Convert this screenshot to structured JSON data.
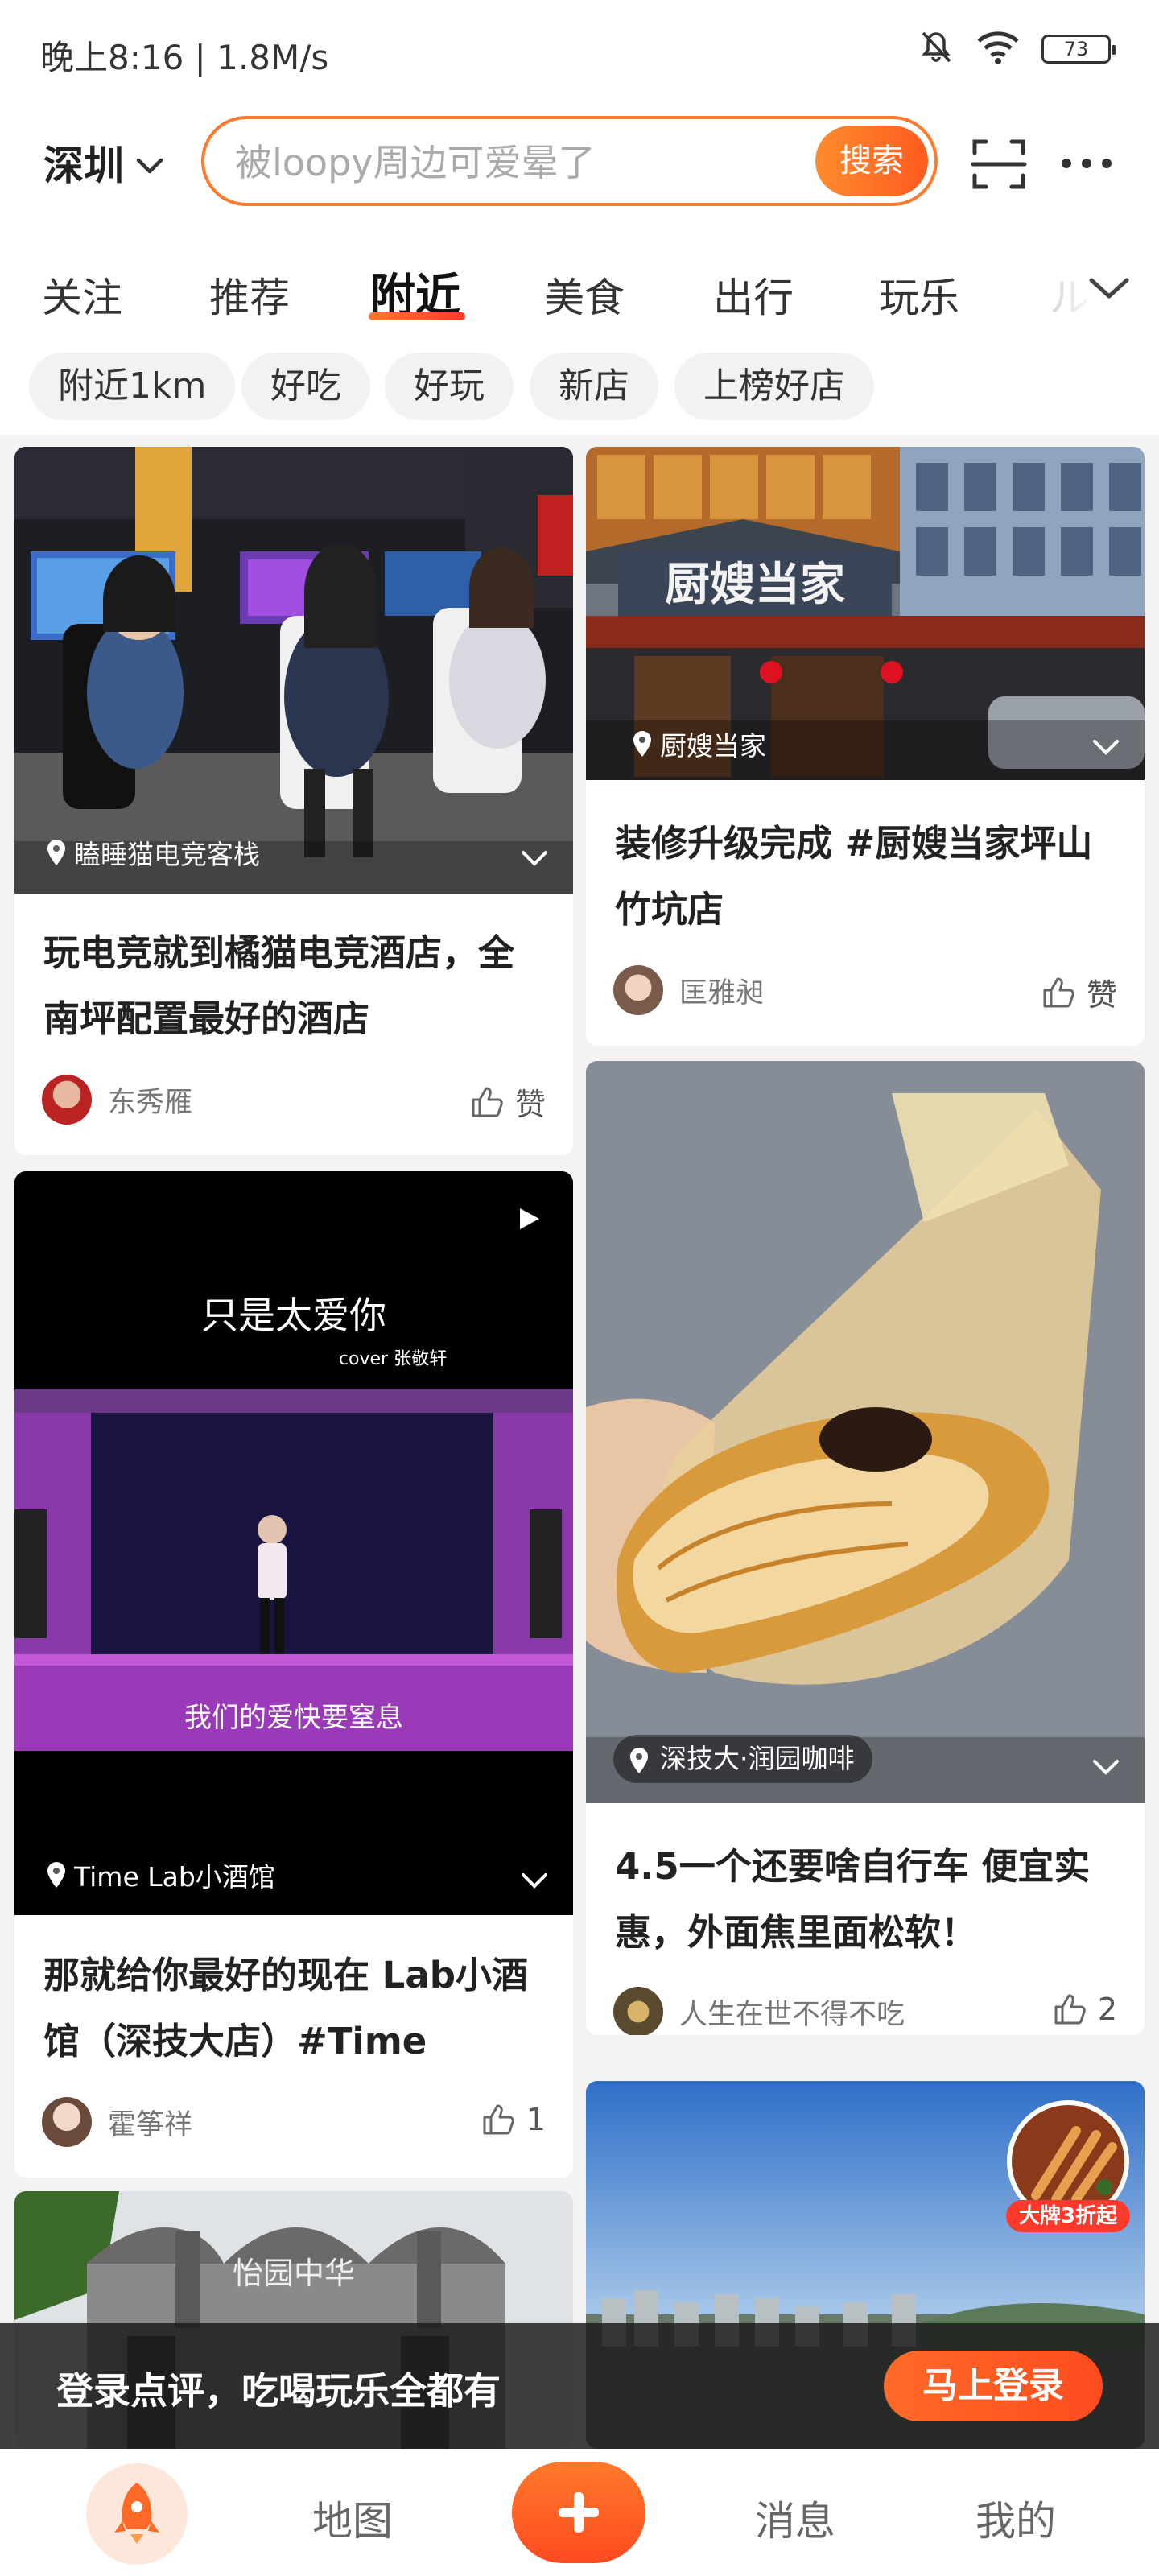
{
  "status_bar": {
    "time_speed": "晚上8:16 | 1.8M/s",
    "battery": "73"
  },
  "header": {
    "city": "深圳",
    "search_placeholder": "被loopy周边可爱晕了",
    "search_button": "搜索"
  },
  "tabs": [
    {
      "label": "关注"
    },
    {
      "label": "推荐"
    },
    {
      "label": "附近",
      "active": true
    },
    {
      "label": "美食"
    },
    {
      "label": "出行"
    },
    {
      "label": "玩乐"
    },
    {
      "label": "ル"
    }
  ],
  "filters": [
    "附近1km",
    "好吃",
    "好玩",
    "新店",
    "上榜好店"
  ],
  "cards": [
    {
      "poi": "瞌睡猫电竞客栈",
      "title": "玩电竞就到橘猫电竞酒店，全南坪配置最好的酒店",
      "author": "东秀雁",
      "likes": "赞"
    },
    {
      "poi": "厨嫂当家",
      "title": "装修升级完成 #厨嫂当家坪山竹坑店",
      "author": "匡雅昶",
      "likes": "赞",
      "image_text": "厨嫂当家"
    },
    {
      "poi": "Time Lab小酒馆",
      "title": "那就给你最好的现在 Lab小酒馆（深技大店）#Time",
      "author": "霍筝祥",
      "likes": "1",
      "image_text_top": "只是太爱你",
      "image_text_sub": "cover 张敬轩",
      "image_text_bottom": "我们的爱快要窒息"
    },
    {
      "poi": "深技大·润园咖啡",
      "title": "4.5一个还要啥自行车 便宜实惠，外面焦里面松软！",
      "author": "人生在世不得不吃",
      "likes": "2"
    },
    {
      "image_text": "怡园中华"
    },
    {
      "promo": "大牌3折起"
    }
  ],
  "login_banner": {
    "text": "登录点评，吃喝玩乐全都有",
    "button": "马上登录"
  },
  "bottom_nav": {
    "map": "地图",
    "messages": "消息",
    "mine": "我的"
  },
  "colors": {
    "accent": "#ff6a28"
  }
}
